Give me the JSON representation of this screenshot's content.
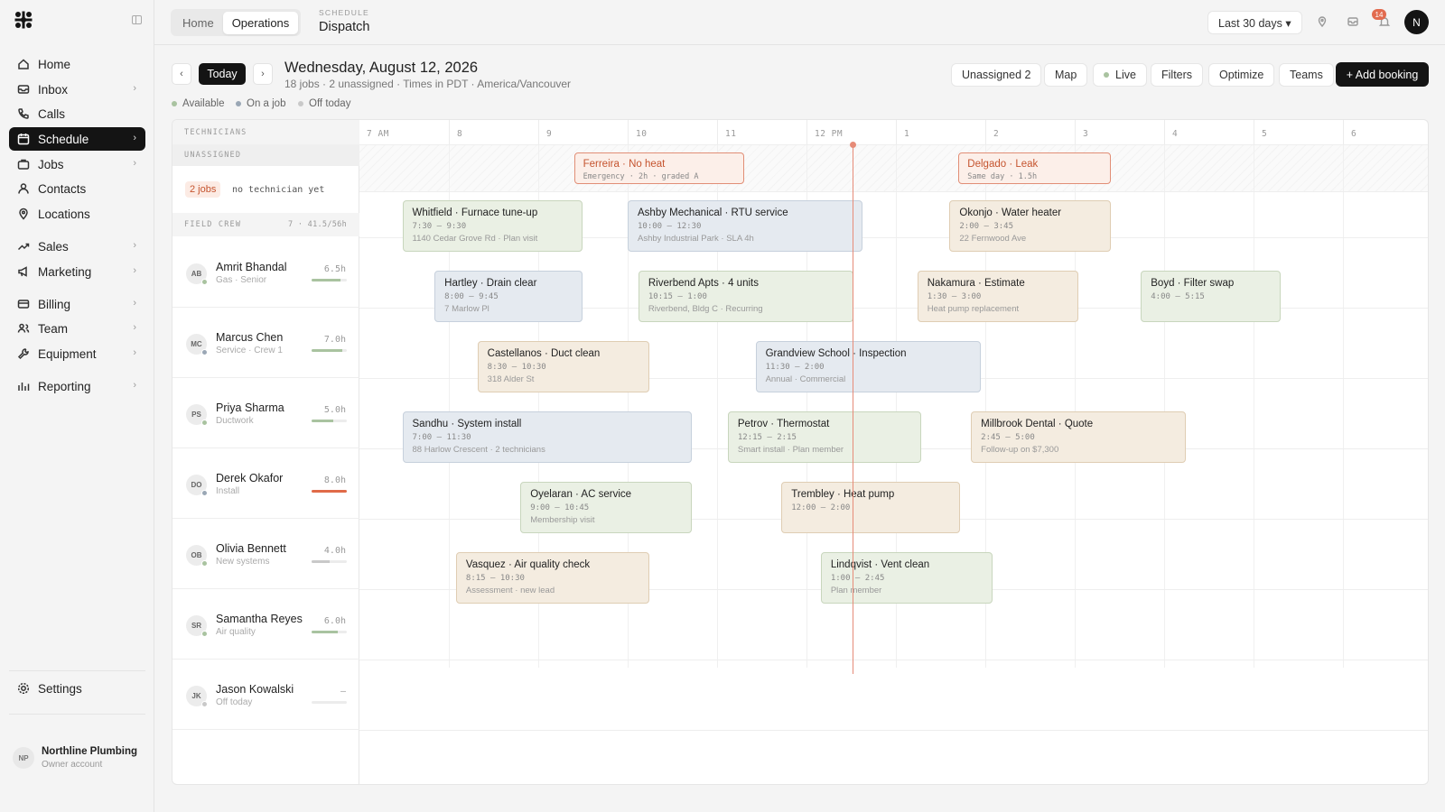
{
  "sidebar": {
    "nav": [
      {
        "label": "Home",
        "icon": "home-icon",
        "chevron": false
      },
      {
        "label": "Inbox",
        "icon": "inbox-icon",
        "chevron": true
      },
      {
        "label": "Calls",
        "icon": "phone-icon",
        "chevron": false
      },
      {
        "label": "Schedule",
        "icon": "calendar-icon",
        "chevron": true,
        "active": true
      },
      {
        "label": "Jobs",
        "icon": "briefcase-icon",
        "chevron": true
      },
      {
        "label": "Contacts",
        "icon": "user-icon",
        "chevron": false
      },
      {
        "label": "Locations",
        "icon": "pin-icon",
        "chevron": false
      },
      {
        "label": "Sales",
        "icon": "trend-icon",
        "chevron": true
      },
      {
        "label": "Marketing",
        "icon": "megaphone-icon",
        "chevron": true
      },
      {
        "label": "Billing",
        "icon": "card-icon",
        "chevron": true
      },
      {
        "label": "Team",
        "icon": "team-icon",
        "chevron": true
      },
      {
        "label": "Equipment",
        "icon": "wrench-icon",
        "chevron": true
      },
      {
        "label": "Reporting",
        "icon": "bars-icon",
        "chevron": true
      }
    ],
    "settings_label": "Settings",
    "org": {
      "initials": "NP",
      "name": "Northline Plumbing",
      "sub": "Owner account"
    },
    "chevron": "›"
  },
  "topbar": {
    "crumbs": [
      "Home",
      "Operations"
    ],
    "kicker": "SCHEDULE",
    "title": "Dispatch",
    "range_label": "Last 30 days ▾",
    "notif_count": "14",
    "user_initial": "N"
  },
  "header": {
    "prev": "‹",
    "next": "›",
    "today": "Today",
    "date": "Wednesday, August 12, 2026",
    "summary": "18 jobs · 2 unassigned · Times in PDT · America/Vancouver",
    "buttons": {
      "unassigned": "Unassigned 2",
      "map": "Map",
      "live": "Live",
      "filters": "Filters",
      "optimize": "Optimize",
      "teams": "Teams"
    },
    "add_booking": "+ Add booking",
    "legend": [
      {
        "label": "Available",
        "color": "#a9c3a0"
      },
      {
        "label": "On a job",
        "color": "#9aa7b5"
      },
      {
        "label": "Off today",
        "color": "#c9c9c9"
      }
    ]
  },
  "board": {
    "technicians_head": "TECHNICIANS",
    "unassigned_head": "UNASSIGNED",
    "unassigned_badge": "2 jobs",
    "unassigned_note": "no technician yet",
    "crew_head": "FIELD CREW",
    "crew_count": "7 · 41.5/56h",
    "hours": [
      "7 AM",
      "8",
      "9",
      "10",
      "11",
      "12 PM",
      "1",
      "2",
      "3",
      "4",
      "5",
      "6"
    ],
    "technicians": [
      {
        "initials": "AB",
        "name": "Amrit Bhandal",
        "role": "Gas · Senior",
        "hours": "6.5h",
        "load": 0.81,
        "bar": "#a9c3a0",
        "status": "#a9c3a0"
      },
      {
        "initials": "MC",
        "name": "Marcus Chen",
        "role": "Service · Crew 1",
        "hours": "7.0h",
        "load": 0.88,
        "bar": "#a9c3a0",
        "status": "#9aa7b5"
      },
      {
        "initials": "PS",
        "name": "Priya Sharma",
        "role": "Ductwork",
        "hours": "5.0h",
        "load": 0.62,
        "bar": "#a9c3a0",
        "status": "#a9c3a0"
      },
      {
        "initials": "DO",
        "name": "Derek Okafor",
        "role": "Install",
        "hours": "8.0h",
        "load": 1.0,
        "bar": "#e06a48",
        "status": "#9aa7b5"
      },
      {
        "initials": "OB",
        "name": "Olivia Bennett",
        "role": "New systems",
        "hours": "4.0h",
        "load": 0.5,
        "bar": "#c9c9c9",
        "status": "#a9c3a0"
      },
      {
        "initials": "SR",
        "name": "Samantha Reyes",
        "role": "Air quality",
        "hours": "6.0h",
        "load": 0.75,
        "bar": "#a9c3a0",
        "status": "#a9c3a0"
      },
      {
        "initials": "JK",
        "name": "Jason Kowalski",
        "role": "Off today",
        "hours": "—",
        "load": 0,
        "bar": "#c9c9c9",
        "status": "#c9c9c9"
      }
    ],
    "unassigned_jobs": [
      {
        "title": "Ferreira · No heat",
        "meta": "Emergency · 2h · graded A",
        "start": 9.4,
        "end": 11.3
      },
      {
        "title": "Delgado · Leak",
        "meta": "Same day · 1.5h",
        "start": 13.7,
        "end": 15.4
      }
    ],
    "jobs": [
      {
        "row": 0,
        "title": "Whitfield · Furnace tune-up",
        "time": "7:30 — 9:30",
        "detail": "1140 Cedar Grove Rd · Plan visit",
        "start": 7.48,
        "end": 9.5,
        "style": "green"
      },
      {
        "row": 0,
        "title": "Ashby Mechanical · RTU service",
        "time": "10:00 — 12:30",
        "detail": "Ashby Industrial Park · SLA 4h",
        "start": 10.0,
        "end": 12.63,
        "style": "blue"
      },
      {
        "row": 0,
        "title": "Okonjo · Water heater",
        "time": "2:00 — 3:45",
        "detail": "22 Fernwood Ave",
        "start": 13.6,
        "end": 15.4,
        "style": "tan"
      },
      {
        "row": 1,
        "title": "Hartley · Drain clear",
        "time": "8:00 — 9:45",
        "detail": "7 Marlow Pl",
        "start": 7.84,
        "end": 9.5,
        "style": "blue"
      },
      {
        "row": 1,
        "title": "Riverbend Apts · 4 units",
        "time": "10:15 — 1:00",
        "detail": "Riverbend, Bldg C · Recurring",
        "start": 10.12,
        "end": 12.53,
        "style": "green"
      },
      {
        "row": 1,
        "title": "Nakamura · Estimate",
        "time": "1:30 — 3:00",
        "detail": "Heat pump replacement",
        "start": 13.24,
        "end": 15.04,
        "style": "tan"
      },
      {
        "row": 1,
        "title": "Boyd · Filter swap",
        "time": "4:00 — 5:15",
        "detail": "",
        "start": 15.74,
        "end": 17.3,
        "style": "green"
      },
      {
        "row": 2,
        "title": "Castellanos · Duct clean",
        "time": "8:30 — 10:30",
        "detail": "318 Alder St",
        "start": 8.32,
        "end": 10.24,
        "style": "tan"
      },
      {
        "row": 2,
        "title": "Grandview School · Inspection",
        "time": "11:30 — 2:00",
        "detail": "Annual · Commercial",
        "start": 11.43,
        "end": 13.95,
        "style": "blue"
      },
      {
        "row": 3,
        "title": "Sandhu · System install",
        "time": "7:00 — 11:30",
        "detail": "88 Harlow Crescent · 2 technicians",
        "start": 7.48,
        "end": 10.72,
        "style": "blue"
      },
      {
        "row": 3,
        "title": "Petrov · Thermostat",
        "time": "12:15 — 2:15",
        "detail": "Smart install · Plan member",
        "start": 11.12,
        "end": 13.28,
        "style": "green"
      },
      {
        "row": 3,
        "title": "Millbrook Dental · Quote",
        "time": "2:45 — 5:00",
        "detail": "Follow-up on $7,300",
        "start": 13.84,
        "end": 16.24,
        "style": "tan"
      },
      {
        "row": 4,
        "title": "Oyelaran · AC service",
        "time": "9:00 — 10:45",
        "detail": "Membership visit",
        "start": 8.8,
        "end": 10.72,
        "style": "green"
      },
      {
        "row": 4,
        "title": "Trembley · Heat pump",
        "time": "12:00 — 2:00",
        "detail": "",
        "start": 11.72,
        "end": 13.72,
        "style": "tan"
      },
      {
        "row": 5,
        "title": "Vasquez · Air quality check",
        "time": "8:15 — 10:30",
        "detail": "Assessment · new lead",
        "start": 8.08,
        "end": 10.24,
        "style": "tan"
      },
      {
        "row": 5,
        "title": "Lindqvist · Vent clean",
        "time": "1:00 — 2:45",
        "detail": "Plan member",
        "start": 12.16,
        "end": 14.08,
        "style": "green"
      }
    ],
    "now_hour": 12.52
  }
}
